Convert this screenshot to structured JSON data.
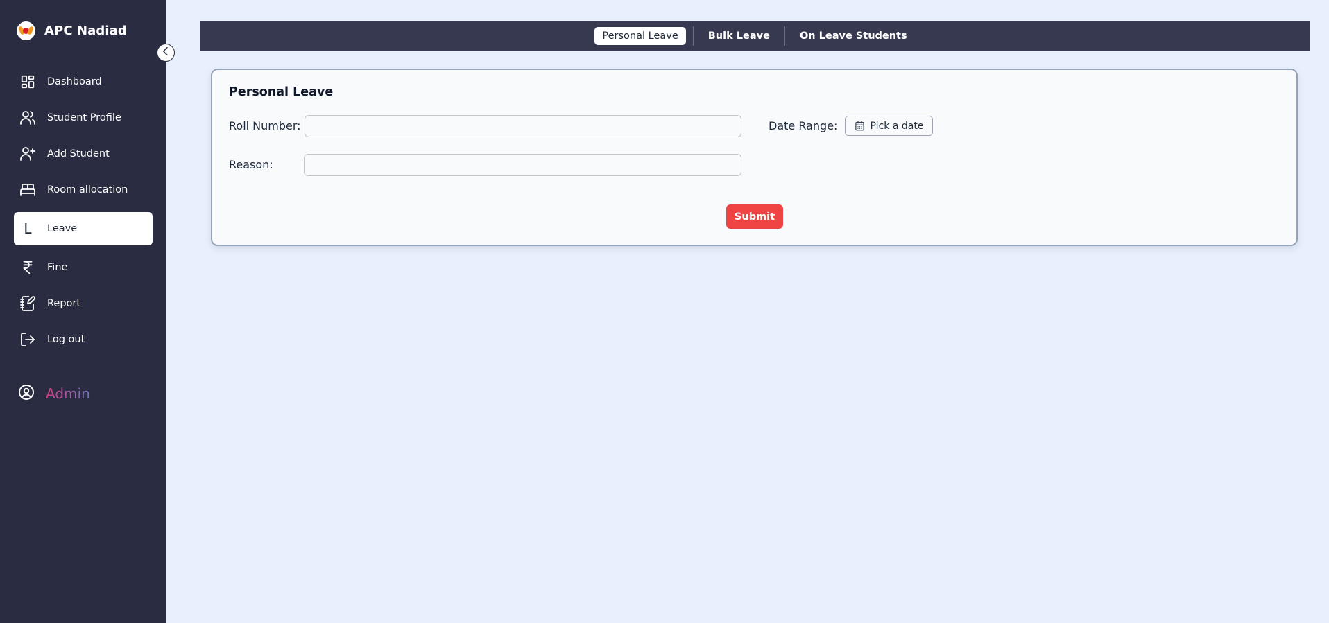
{
  "brand": {
    "name": "APC Nadiad",
    "logo_icon": "apc-logo"
  },
  "sidebar": {
    "collapse_icon": "chevron-left-icon",
    "items": [
      {
        "label": "Dashboard",
        "icon": "dashboard-grid-icon",
        "active": false
      },
      {
        "label": "Student Profile",
        "icon": "users-icon",
        "active": false
      },
      {
        "label": "Add Student",
        "icon": "user-plus-icon",
        "active": false
      },
      {
        "label": "Room allocation",
        "icon": "bed-icon",
        "active": false
      },
      {
        "label": "Leave",
        "icon": "letter-l-icon",
        "icon_glyph": "L",
        "active": true
      },
      {
        "label": "Fine",
        "icon": "rupee-icon",
        "active": false
      },
      {
        "label": "Report",
        "icon": "notebook-pen-icon",
        "active": false
      },
      {
        "label": "Log out",
        "icon": "logout-icon",
        "active": false
      }
    ],
    "user": {
      "label": "Admin",
      "icon": "user-circle-icon"
    }
  },
  "tabs": [
    {
      "label": "Personal Leave",
      "active": true
    },
    {
      "label": "Bulk Leave",
      "active": false
    },
    {
      "label": "On Leave Students",
      "active": false
    }
  ],
  "form": {
    "title": "Personal Leave",
    "roll_number": {
      "label": "Roll Number:",
      "value": "",
      "placeholder": ""
    },
    "reason": {
      "label": "Reason:",
      "value": "",
      "placeholder": ""
    },
    "date_range": {
      "label": "Date Range:",
      "button_label": "Pick a date",
      "icon": "calendar-icon"
    },
    "submit_label": "Submit"
  },
  "colors": {
    "sidebar_bg": "#2a2d42",
    "topbar_bg": "#36394f",
    "page_bg": "#e9f0fd",
    "submit_bg": "#ef4444",
    "admin_gradient_start": "#d63e87",
    "admin_gradient_end": "#6f79c2"
  }
}
